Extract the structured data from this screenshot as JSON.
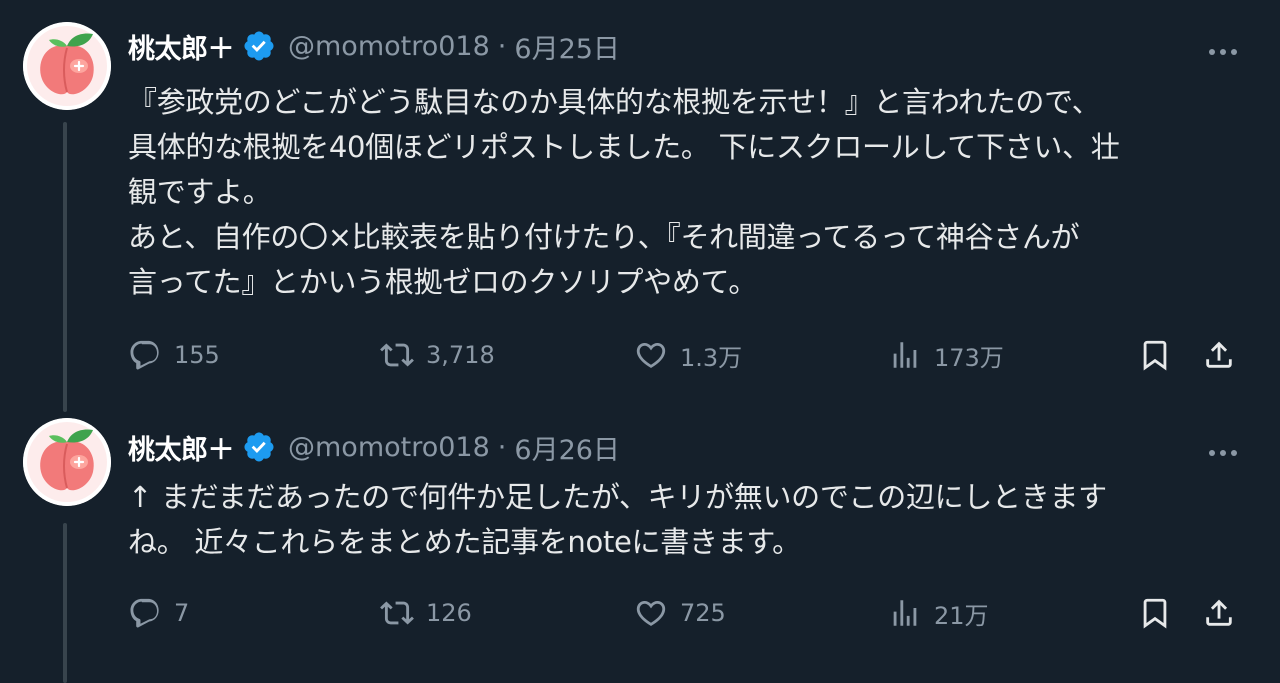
{
  "tweets": [
    {
      "display_name": "桃太郎＋",
      "handle": "@momotro018",
      "separator": "·",
      "date": "6月25日",
      "body_lines": [
        "『参政党のどこがどう駄目なのか具体的な根拠を示せ！』と言われたので、",
        "具体的な根拠を40個ほどリポストしました。 下にスクロールして下さい、壮",
        "観ですよ。",
        "あと、自作の〇×比較表を貼り付けたり、『それ間違ってるって神谷さんが",
        "言ってた』とかいう根拠ゼロのクソリプやめて。"
      ],
      "stats": {
        "replies": "155",
        "retweets": "3,718",
        "likes": "1.3万",
        "views": "173万"
      }
    },
    {
      "display_name": "桃太郎＋",
      "handle": "@momotro018",
      "separator": "·",
      "date": "6月26日",
      "body_lines": [
        "↑ まだまだあったので何件か足したが、キリが無いのでこの辺にしときます",
        "ね。 近々これらをまとめた記事をnoteに書きます。"
      ],
      "stats": {
        "replies": "7",
        "retweets": "126",
        "likes": "725",
        "views": "21万"
      }
    }
  ],
  "icons": {
    "avatar": "peach-avatar-icon",
    "verified": "verified-badge-icon",
    "more": "more-horizontal-icon",
    "reply": "reply-icon",
    "retweet": "retweet-icon",
    "like": "heart-icon",
    "views": "views-icon",
    "bookmark": "bookmark-icon",
    "share": "share-icon"
  },
  "colors": {
    "background": "#15202b",
    "text": "#e7e9ea",
    "muted": "#8b98a5",
    "verified": "#1d9bf0",
    "thread_line": "#38444d"
  }
}
